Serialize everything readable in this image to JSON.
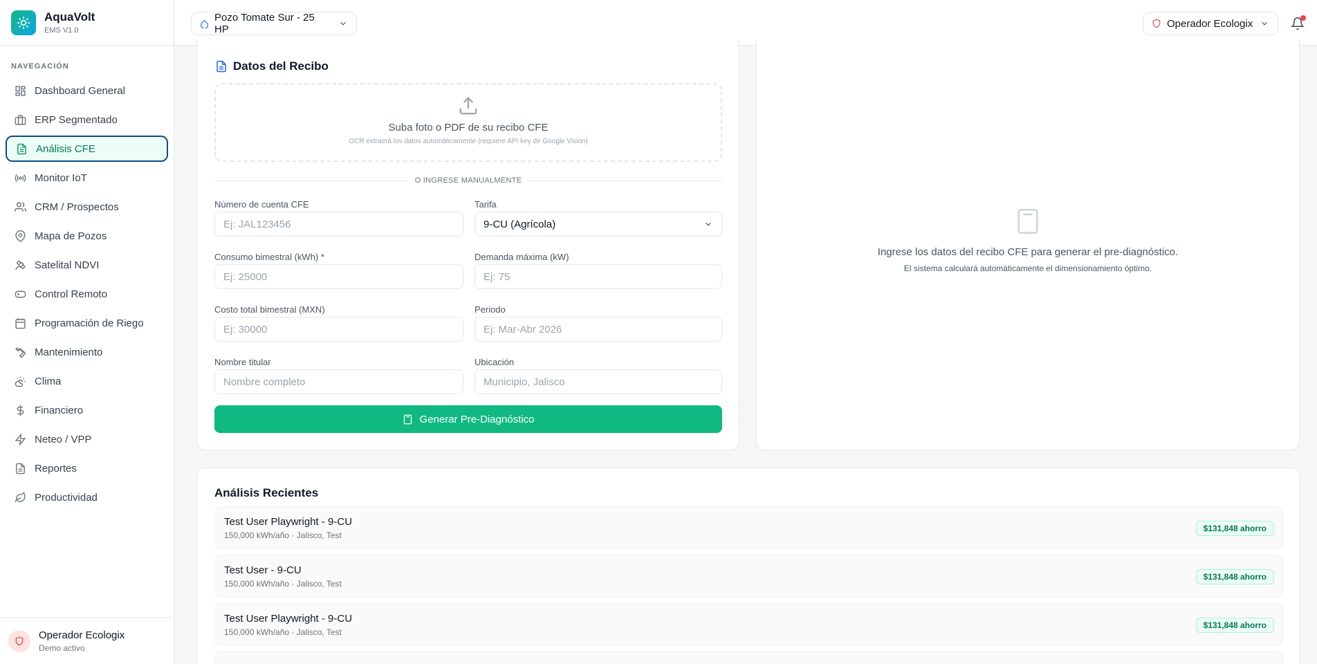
{
  "app": {
    "name": "AquaVolt",
    "version": "EMS V1.0"
  },
  "sidebar": {
    "section_title": "NAVEGACIÓN",
    "items": [
      {
        "label": "Dashboard General",
        "icon": "dashboard-icon"
      },
      {
        "label": "ERP Segmentado",
        "icon": "briefcase-icon"
      },
      {
        "label": "Análisis CFE",
        "icon": "document-icon",
        "active": true
      },
      {
        "label": "Monitor IoT",
        "icon": "broadcast-icon"
      },
      {
        "label": "CRM / Prospectos",
        "icon": "users-icon"
      },
      {
        "label": "Mapa de Pozos",
        "icon": "map-pin-icon"
      },
      {
        "label": "Satelital NDVI",
        "icon": "satellite-icon"
      },
      {
        "label": "Control Remoto",
        "icon": "gamepad-icon"
      },
      {
        "label": "Programación de Riego",
        "icon": "calendar-icon"
      },
      {
        "label": "Mantenimiento",
        "icon": "wrench-icon"
      },
      {
        "label": "Clima",
        "icon": "cloud-sun-icon"
      },
      {
        "label": "Financiero",
        "icon": "dollar-icon"
      },
      {
        "label": "Neteo / VPP",
        "icon": "bolt-icon"
      },
      {
        "label": "Reportes",
        "icon": "report-icon"
      },
      {
        "label": "Productividad",
        "icon": "leaf-icon"
      }
    ],
    "footer": {
      "user": "Operador Ecologix",
      "status": "Demo activo"
    }
  },
  "header": {
    "pozo_select": "Pozo Tomate Sur - 25 HP",
    "operator": "Operador Ecologix"
  },
  "form": {
    "title": "Datos del Recibo",
    "upload_title": "Suba foto o PDF de su recibo CFE",
    "upload_sub": "OCR extraerá los datos automáticamente (requiere API key de Google Vision)",
    "divider": "O INGRESE MANUALMENTE",
    "fields": {
      "cuenta": {
        "label": "Número de cuenta CFE",
        "placeholder": "Ej: JAL123456"
      },
      "tarifa": {
        "label": "Tarifa",
        "value": "9-CU (Agrícola)"
      },
      "consumo": {
        "label": "Consumo bimestral (kWh) *",
        "placeholder": "Ej: 25000"
      },
      "demanda": {
        "label": "Demanda máxima (kW)",
        "placeholder": "Ej: 75"
      },
      "costo": {
        "label": "Costo total bimestral (MXN)",
        "placeholder": "Ej: 30000"
      },
      "periodo": {
        "label": "Periodo",
        "placeholder": "Ej: Mar-Abr 2026"
      },
      "titular": {
        "label": "Nombre titular",
        "placeholder": "Nombre completo"
      },
      "ubicacion": {
        "label": "Ubicación",
        "placeholder": "Municipio, Jalisco"
      }
    },
    "button": "Generar Pre-Diagnóstico"
  },
  "result": {
    "main": "Ingrese los datos del recibo CFE para generar el pre-diagnóstico.",
    "sub": "El sistema calculará automáticamente el dimensionamiento óptimo."
  },
  "recent": {
    "title": "Análisis Recientes",
    "items": [
      {
        "title": "Test User Playwright - 9-CU",
        "sub": "150,000 kWh/año · Jalisco, Test",
        "badge": "$131,848 ahorro"
      },
      {
        "title": "Test User - 9-CU",
        "sub": "150,000 kWh/año · Jalisco, Test",
        "badge": "$131,848 ahorro"
      },
      {
        "title": "Test User Playwright - 9-CU",
        "sub": "150,000 kWh/año · Jalisco, Test",
        "badge": "$131,848 ahorro"
      }
    ]
  },
  "colors": {
    "accent": "#10b981",
    "brand": "#0ea5e9",
    "active_border": "#0f4c81",
    "alert": "#ef4444"
  }
}
